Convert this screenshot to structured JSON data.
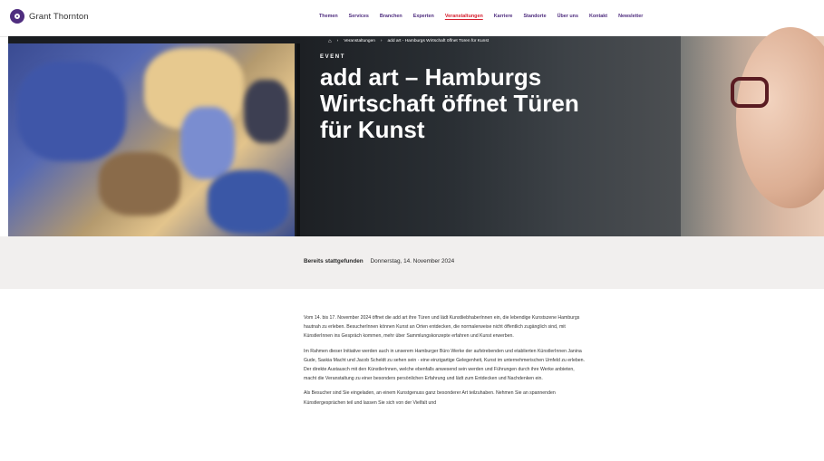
{
  "brand": {
    "name": "Grant Thornton"
  },
  "nav": {
    "items": [
      {
        "label": "Themen"
      },
      {
        "label": "Services"
      },
      {
        "label": "Branchen"
      },
      {
        "label": "Experten"
      },
      {
        "label": "Veranstaltungen",
        "active": true
      },
      {
        "label": "Karriere"
      },
      {
        "label": "Standorte"
      },
      {
        "label": "Über uns"
      },
      {
        "label": "Kontakt"
      },
      {
        "label": "Newsletter"
      }
    ]
  },
  "breadcrumb": {
    "home_icon": "home-icon",
    "items": [
      "Veranstaltungen",
      "add art - Hamburgs Wirtschaft öffnet Türen für Kunst"
    ]
  },
  "hero": {
    "label": "EVENT",
    "title": "add art – Hamburgs Wirtschaft öffnet Türen für Kunst"
  },
  "event_info": {
    "status": "Bereits stattgefunden",
    "date": "Donnerstag, 14. November 2024"
  },
  "article": {
    "paragraphs": [
      "Vom 14. bis 17. November 2024 öffnet die add art ihre Türen und lädt KunstliebhaberInnen ein, die lebendige Kunstszene Hamburgs hautnah zu erleben. BesucherInnen können Kunst an Orten entdecken, die normalerweise nicht öffentlich zugänglich sind, mit KünstlerInnen ins Gespräch kommen, mehr über Sammlungskonzepte erfahren und Kunst erwerben.",
      "Im Rahmen dieser Initiative werden auch in unserem Hamburger Büro Werke der aufstrebenden und etablierten KünstlerInnen Janina Gude, Saskia Macht und Jacob Scheldt zu sehen sein - eine einzigartige Gelegenheit, Kunst im unternehmerischen Umfeld zu erleben. Der direkte Austausch mit den KünstlerInnen, welche ebenfalls anwesend sein werden und Führungen durch ihre Werke anbieten, macht die Veranstaltung zu einer besonders persönlichen Erfahrung und lädt zum Entdecken und Nachdenken ein.",
      "Als Besucher sind Sie eingeladen, an einem Kunstgenuss ganz besonderer Art teilzuhaben. Nehmen Sie an spannenden Künstlergesprächen teil und lassen Sie sich von der Vielfalt und"
    ]
  },
  "colors": {
    "brand_purple": "#4f2d7f",
    "active_nav": "#d6202f",
    "info_band": "#f1efee"
  }
}
